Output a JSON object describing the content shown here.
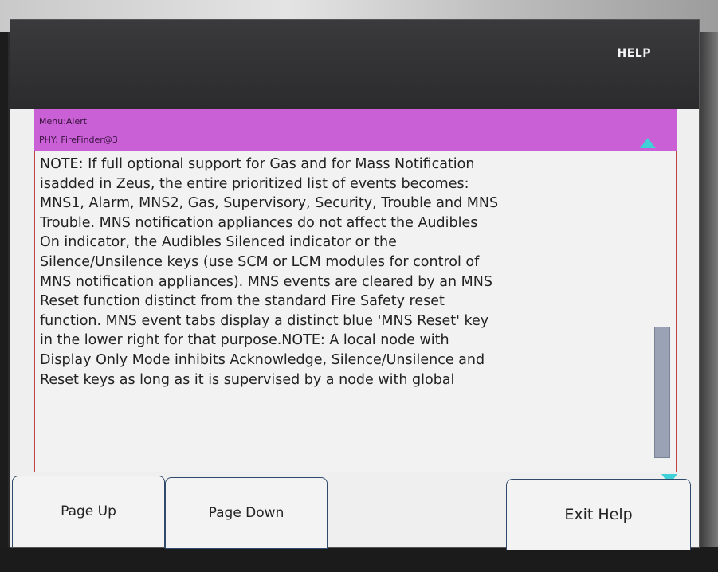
{
  "header": {
    "title": "HELP"
  },
  "menu": {
    "menu_line": "Menu:Alert",
    "phy_line": "PHY: FireFinder@3"
  },
  "help_text": {
    "lines": [
      "NOTE: If full optional support for Gas and for Mass Notification",
      "isadded in Zeus, the entire prioritized list of events becomes:",
      "MNS1, Alarm, MNS2, Gas, Supervisory, Security, Trouble and MNS",
      "Trouble. MNS notification appliances do not affect the Audibles",
      "On indicator, the Audibles Silenced indicator or the",
      "Silence/Unsilence keys (use SCM or LCM modules for control of",
      "MNS notification appliances). MNS events are cleared by an MNS",
      "Reset function distinct from the standard Fire Safety reset",
      "function. MNS event tabs display a distinct blue 'MNS Reset' key",
      "in the lower right for that purpose.NOTE: A local node with",
      "Display Only Mode inhibits Acknowledge, Silence/Unsilence and",
      "Reset keys as long as it is supervised by a node with global"
    ]
  },
  "buttons": {
    "page_up": "Page Up",
    "page_down": "Page Down",
    "exit_help": "Exit Help"
  },
  "colors": {
    "menu_strip": "#c960d6",
    "scroll_arrows": "#3fd0d8",
    "titlebar": "#2f2f32"
  }
}
